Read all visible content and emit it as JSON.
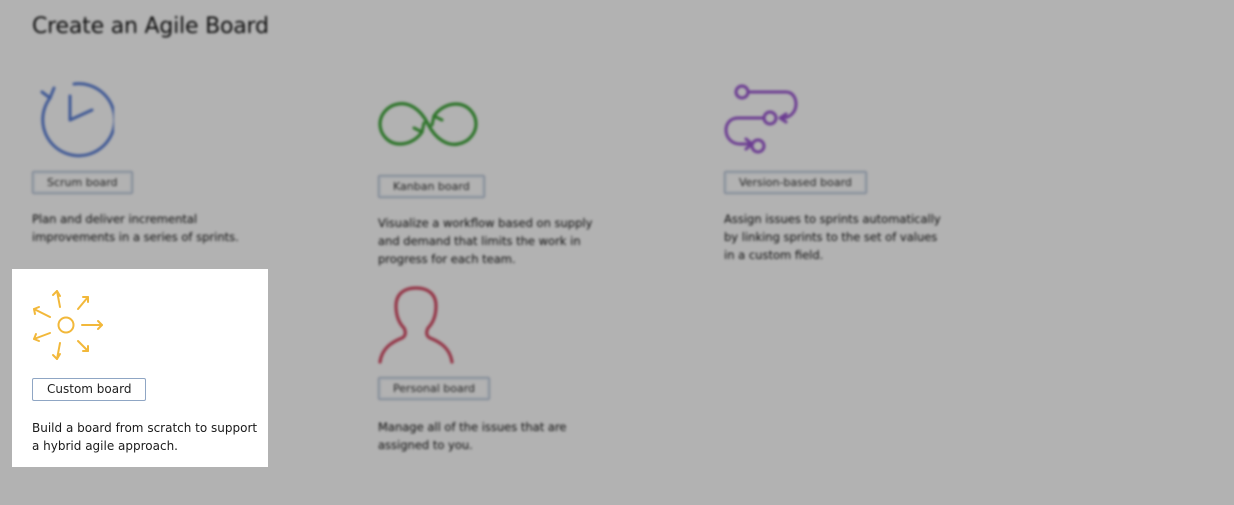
{
  "page": {
    "title": "Create an Agile Board"
  },
  "boards": {
    "scrum": {
      "button_label": "Scrum board",
      "description": "Plan and deliver incremental\nimprovements in a series of sprints.",
      "icon": "clock-icon",
      "color": "#5b7fd6"
    },
    "kanban": {
      "button_label": "Kanban board",
      "description": "Visualize a workflow based on supply\nand demand that limits the work in\nprogress for each team.",
      "icon": "infinity-loop-icon",
      "color": "#3fa63a"
    },
    "version": {
      "button_label": "Version-based board",
      "description": "Assign issues to sprints automatically\nby linking sprints to the set of values\nin a custom field.",
      "icon": "branch-flow-icon",
      "color": "#9a56d1"
    },
    "custom": {
      "button_label": "Custom board",
      "description": "Build a board from scratch to support\na hybrid agile approach.",
      "icon": "sun-burst-icon",
      "color": "#f2b83a"
    },
    "personal": {
      "button_label": "Personal board",
      "description": "Manage all of the issues that are\nassigned to you.",
      "icon": "person-icon",
      "color": "#d44a64"
    }
  }
}
